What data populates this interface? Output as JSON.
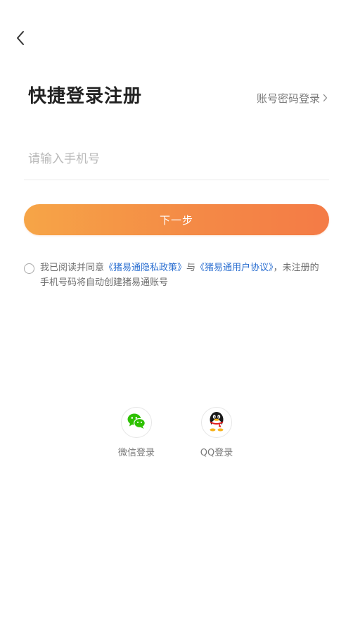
{
  "header": {
    "back_icon": "chevron-left-icon"
  },
  "title": "快捷登录注册",
  "password_login": {
    "label": "账号密码登录",
    "icon": "chevron-right-icon"
  },
  "phone": {
    "value": "",
    "placeholder": "请输入手机号"
  },
  "next_button": {
    "label": "下一步"
  },
  "agreement": {
    "checked": false,
    "prefix": "我已阅读并同意",
    "privacy_link": "《猪易通隐私政策》",
    "connector": "与",
    "user_agreement_link": "《猪易通用户协议》",
    "suffix": "，未注册的手机号码将自动创建猪易通账号"
  },
  "social_login": [
    {
      "label": "微信登录",
      "icon": "wechat-icon"
    },
    {
      "label": "QQ登录",
      "icon": "qq-penguin-icon"
    }
  ],
  "colors": {
    "button_gradient_start": "#f6a547",
    "button_gradient_end": "#f47b46",
    "link": "#2b6fd1",
    "wechat_green": "#2ec100"
  }
}
